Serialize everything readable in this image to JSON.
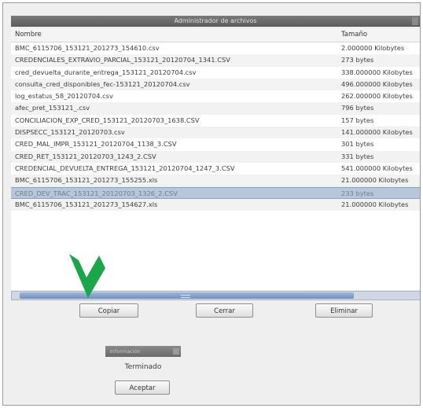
{
  "window": {
    "title": "Administrador de archivos"
  },
  "columns": {
    "name": "Nombre",
    "size": "Tamaño"
  },
  "files": [
    {
      "name": "BMC_6115706_153121_201273_154610.csv",
      "size": "2.000000 Kilobytes"
    },
    {
      "name": "CREDENCIALES_EXTRAVIO_PARCIAL_153121_20120704_1341.CSV",
      "size": "273 bytes"
    },
    {
      "name": "cred_devuelta_durante_entrega_153121_20120704.csv",
      "size": "338.000000 Kilobytes"
    },
    {
      "name": "consulta_cred_disponibles_fec-153121_20120704.csv",
      "size": "496.000000 Kilobytes"
    },
    {
      "name": "log_estatus_58_20120704.csv",
      "size": "262.000000 Kilobytes"
    },
    {
      "name": "afec_pret_153121_.csv",
      "size": "796 bytes"
    },
    {
      "name": "CONCILIACION_EXP_CRED_153121_20120703_1638.CSV",
      "size": "157 bytes"
    },
    {
      "name": "DISPSECC_153121_20120703.csv",
      "size": "141.000000 Kilobytes"
    },
    {
      "name": "CRED_MAL_IMPR_153121_20120704_1138_3.CSV",
      "size": "301 bytes"
    },
    {
      "name": "CRED_RET_153121_20120703_1243_2.CSV",
      "size": "331 bytes"
    },
    {
      "name": "CREDENCIAL_DEVUELTA_ENTREGA_153121_20120704_1247_3.CSV",
      "size": "541.000000 Kilobytes"
    },
    {
      "name": "BMC_6115706_153121_201273_155255.xls",
      "size": "21.000000 Kilobytes"
    },
    {
      "name": "CRED_DEV_TRAC_153121_20120703_1326_2.CSV",
      "size": "233 bytes"
    },
    {
      "name": "BMC_6115706_153121_201273_154627.xls",
      "size": "21.000000 Kilobytes"
    }
  ],
  "selected_index": 12,
  "scroll_position": 0.8,
  "buttons": {
    "copy": "Copiar",
    "close": "Cerrar",
    "delete": "Eliminar"
  },
  "dialog": {
    "title": "Información",
    "message": "Terminado",
    "ok": "Aceptar"
  },
  "colors": {
    "selection": "#b8c6da",
    "arrow": "#1aa64a",
    "scroll_thumb": "#7f9cc8"
  },
  "icons": {
    "pointer": "green-arrow-icon"
  }
}
